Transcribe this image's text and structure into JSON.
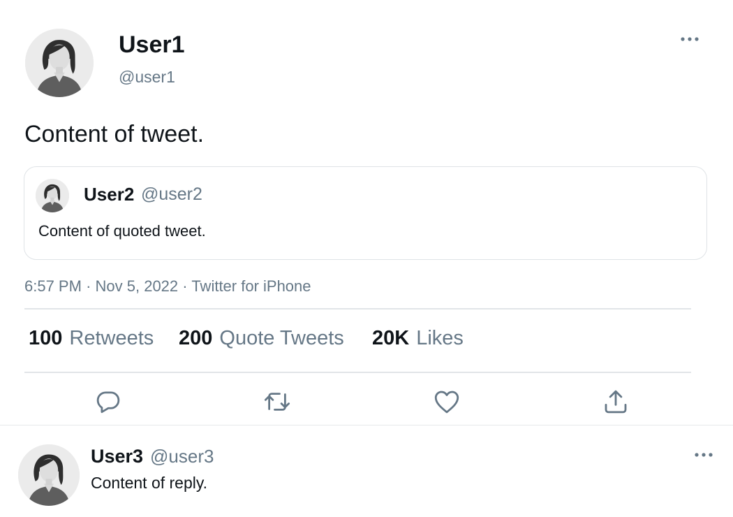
{
  "main_tweet": {
    "name": "User1",
    "handle": "@user1",
    "content": "Content of tweet.",
    "avatar_icon": "user-avatar-icon",
    "more_icon": "more-icon"
  },
  "quoted_tweet": {
    "name": "User2",
    "handle": "@user2",
    "content": "Content of quoted tweet.",
    "avatar_icon": "user-avatar-icon"
  },
  "meta": {
    "time": "6:57 PM",
    "separator": "·",
    "date": "Nov 5, 2022",
    "source": "Twitter for iPhone"
  },
  "stats": {
    "retweets": {
      "count": "100",
      "label": "Retweets"
    },
    "quote_tweets": {
      "count": "200",
      "label": "Quote Tweets"
    },
    "likes": {
      "count": "20K",
      "label": "Likes"
    }
  },
  "actions": {
    "reply_icon": "reply-icon",
    "retweet_icon": "retweet-icon",
    "like_icon": "heart-icon",
    "share_icon": "share-icon"
  },
  "reply_tweet": {
    "name": "User3",
    "handle": "@user3",
    "content": "Content of reply.",
    "avatar_icon": "user-avatar-icon",
    "more_icon": "more-icon"
  },
  "colors": {
    "text": "#0f1419",
    "muted": "#657786",
    "divider": "#e1e5e8",
    "avatar_bg": "#e9e9e9"
  }
}
